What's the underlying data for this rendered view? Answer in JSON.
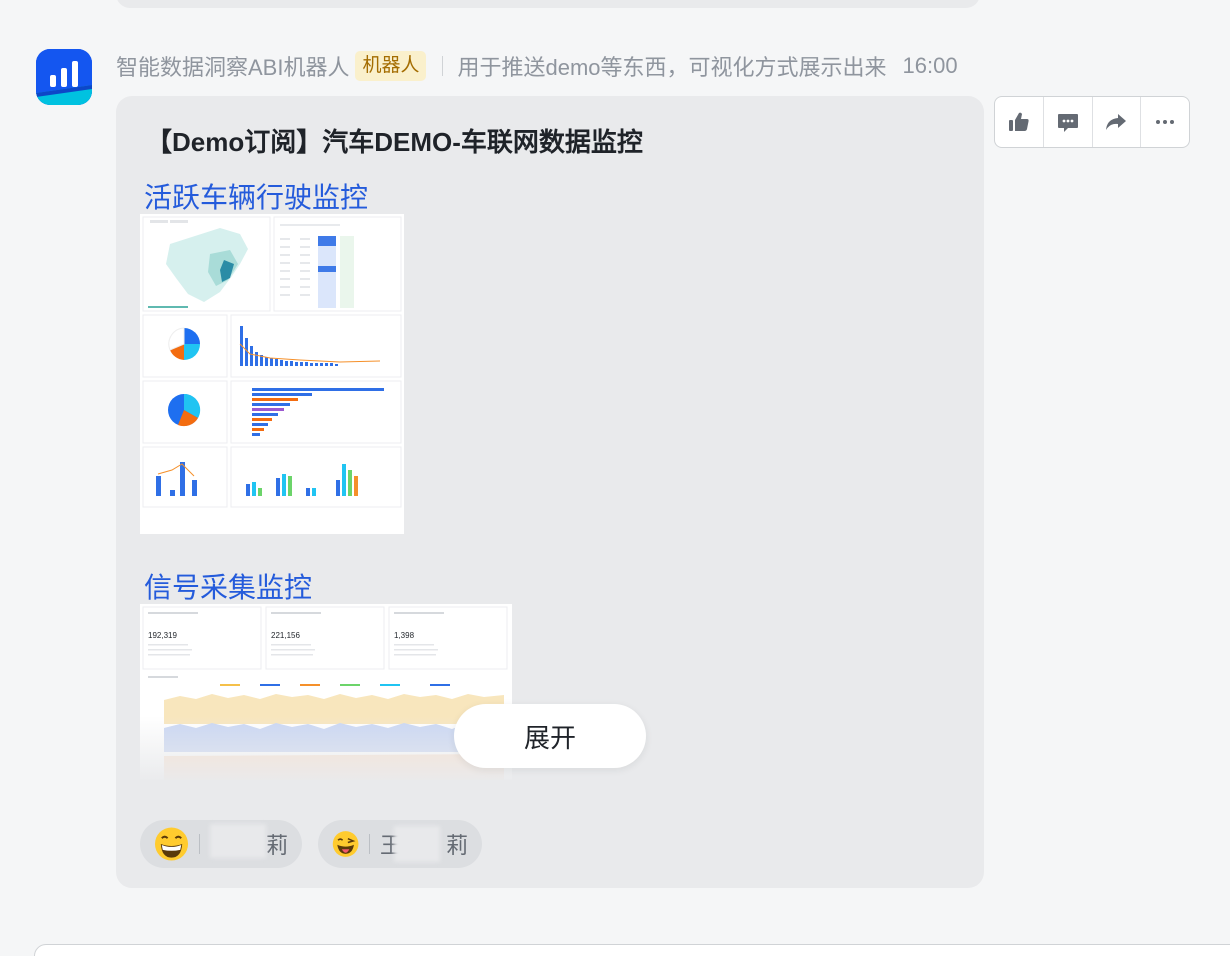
{
  "message": {
    "sender": "智能数据洞察ABI机器人",
    "badge": "机器人",
    "description": "用于推送demo等东西，可视化方式展示出来",
    "time": "16:00"
  },
  "card": {
    "title": "【Demo订阅】汽车DEMO-车联网数据监控",
    "sections": [
      {
        "title": "活跃车辆行驶监控"
      },
      {
        "title": "信号采集监控"
      }
    ],
    "expand_label": "展开"
  },
  "reactions": [
    {
      "emoji": "grinning-face-icon",
      "name_visible_end": "莉"
    },
    {
      "emoji": "winking-tongue-face-icon",
      "name_visible_start": "王",
      "name_visible_end": "莉"
    }
  ],
  "thumbnail2": {
    "kpis": [
      "192,319",
      "221,156",
      "1,398"
    ]
  },
  "colors": {
    "link": "#245bdb",
    "card_bg": "#e9eaec",
    "badge_bg": "#faf0cc",
    "badge_text": "#a46d02",
    "avatar_bg": "#1456f0"
  }
}
